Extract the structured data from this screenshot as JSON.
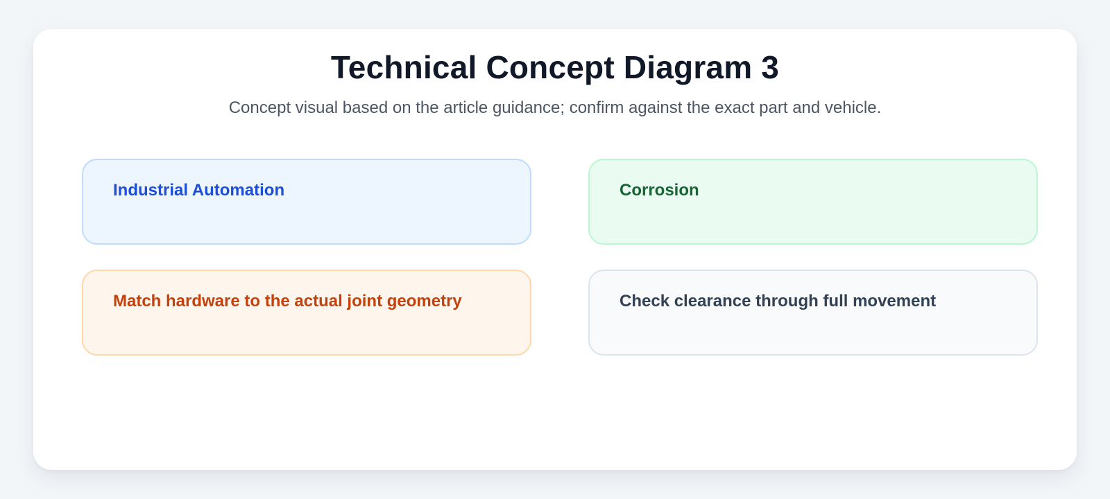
{
  "diagram": {
    "title": "Technical Concept Diagram 3",
    "subtitle": "Concept visual based on the article guidance; confirm against the exact part and vehicle.",
    "boxes": [
      {
        "label": "Industrial Automation",
        "accent": "#1d4ed8",
        "fill": "#edf5fe"
      },
      {
        "label": "Corrosion",
        "accent": "#166534",
        "fill": "#eafcf2"
      },
      {
        "label": "Match hardware to the actual joint geometry",
        "accent": "#c2410c",
        "fill": "#fef6ec"
      },
      {
        "label": "Check clearance through full movement",
        "accent": "#334155",
        "fill": "#f8fafc"
      }
    ]
  }
}
